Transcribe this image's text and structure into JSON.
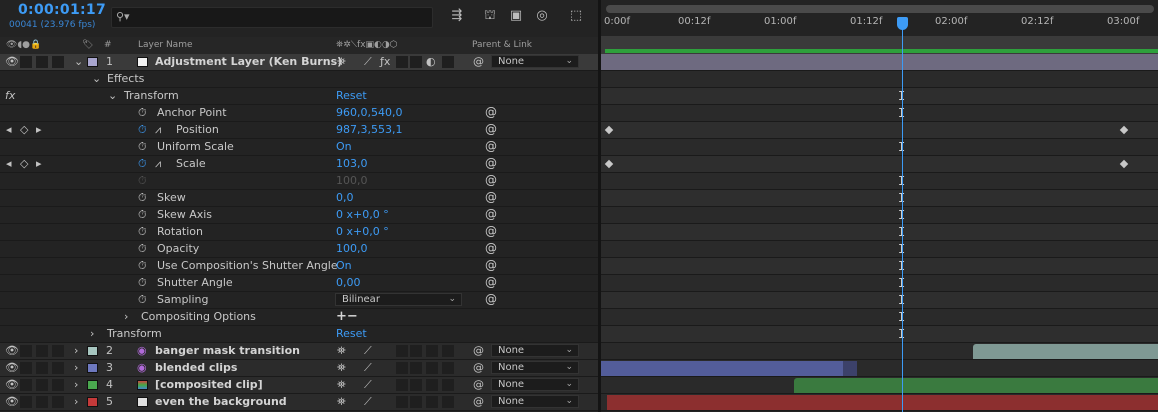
{
  "header": {
    "timecode": "0:00:01:17",
    "frames_fps": "00041 (23.976 fps)",
    "search_placeholder": "⚲▾"
  },
  "columns": {
    "hash": "#",
    "layer_name": "Layer Name",
    "parent_link": "Parent & Link"
  },
  "parent_value": "None",
  "layers": [
    {
      "num": "1",
      "name": "Adjustment Layer (Ken Burns)",
      "color": "#a9a6cf"
    },
    {
      "num": "2",
      "name": "banger mask transition",
      "color": "#a7c6c0"
    },
    {
      "num": "3",
      "name": "blended clips",
      "color": "#6e79bf"
    },
    {
      "num": "4",
      "name": "[composited clip]",
      "color": "#4aa84f"
    },
    {
      "num": "5",
      "name": "even the background",
      "color": "#c43a3a"
    }
  ],
  "props": {
    "effects": "Effects",
    "transform": "Transform",
    "reset": "Reset",
    "anchor_point": {
      "label": "Anchor Point",
      "value": "960,0,540,0"
    },
    "position": {
      "label": "Position",
      "value": "987,3,553,1"
    },
    "uniform_scale": {
      "label": "Uniform Scale",
      "value": "On"
    },
    "scale": {
      "label": "Scale",
      "value": "103,0"
    },
    "scale_dim": {
      "value": "100,0"
    },
    "skew": {
      "label": "Skew",
      "value": "0,0"
    },
    "skew_axis": {
      "label": "Skew Axis",
      "value": "0 x+0,0 °"
    },
    "rotation": {
      "label": "Rotation",
      "value": "0 x+0,0 °"
    },
    "opacity": {
      "label": "Opacity",
      "value": "100,0"
    },
    "use_shutter": {
      "label": "Use Composition's Shutter Angle",
      "value": "On"
    },
    "shutter_angle": {
      "label": "Shutter Angle",
      "value": "0,00"
    },
    "sampling": {
      "label": "Sampling",
      "value": "Bilinear"
    },
    "compositing": {
      "label": "Compositing Options",
      "value": "+−"
    },
    "transform2": "Transform",
    "reset2": "Reset",
    "fx": "fx"
  },
  "timeline": {
    "ticks": [
      "0:00f",
      "00:12f",
      "01:00f",
      "01:12f",
      "02:00f",
      "02:12f",
      "03:00f"
    ],
    "current_time": "01:17",
    "bars": [
      {
        "layer": 2,
        "color": "#7f9994",
        "start": "02:01f"
      },
      {
        "layer": 3,
        "color": "#535d9a",
        "end": "01:06f"
      },
      {
        "layer": 4,
        "color": "#3a7a3f",
        "start": "00:23f"
      },
      {
        "layer": 5,
        "color": "#8c2f2f"
      }
    ]
  },
  "colors": {
    "accent": "#3d9bf5"
  }
}
